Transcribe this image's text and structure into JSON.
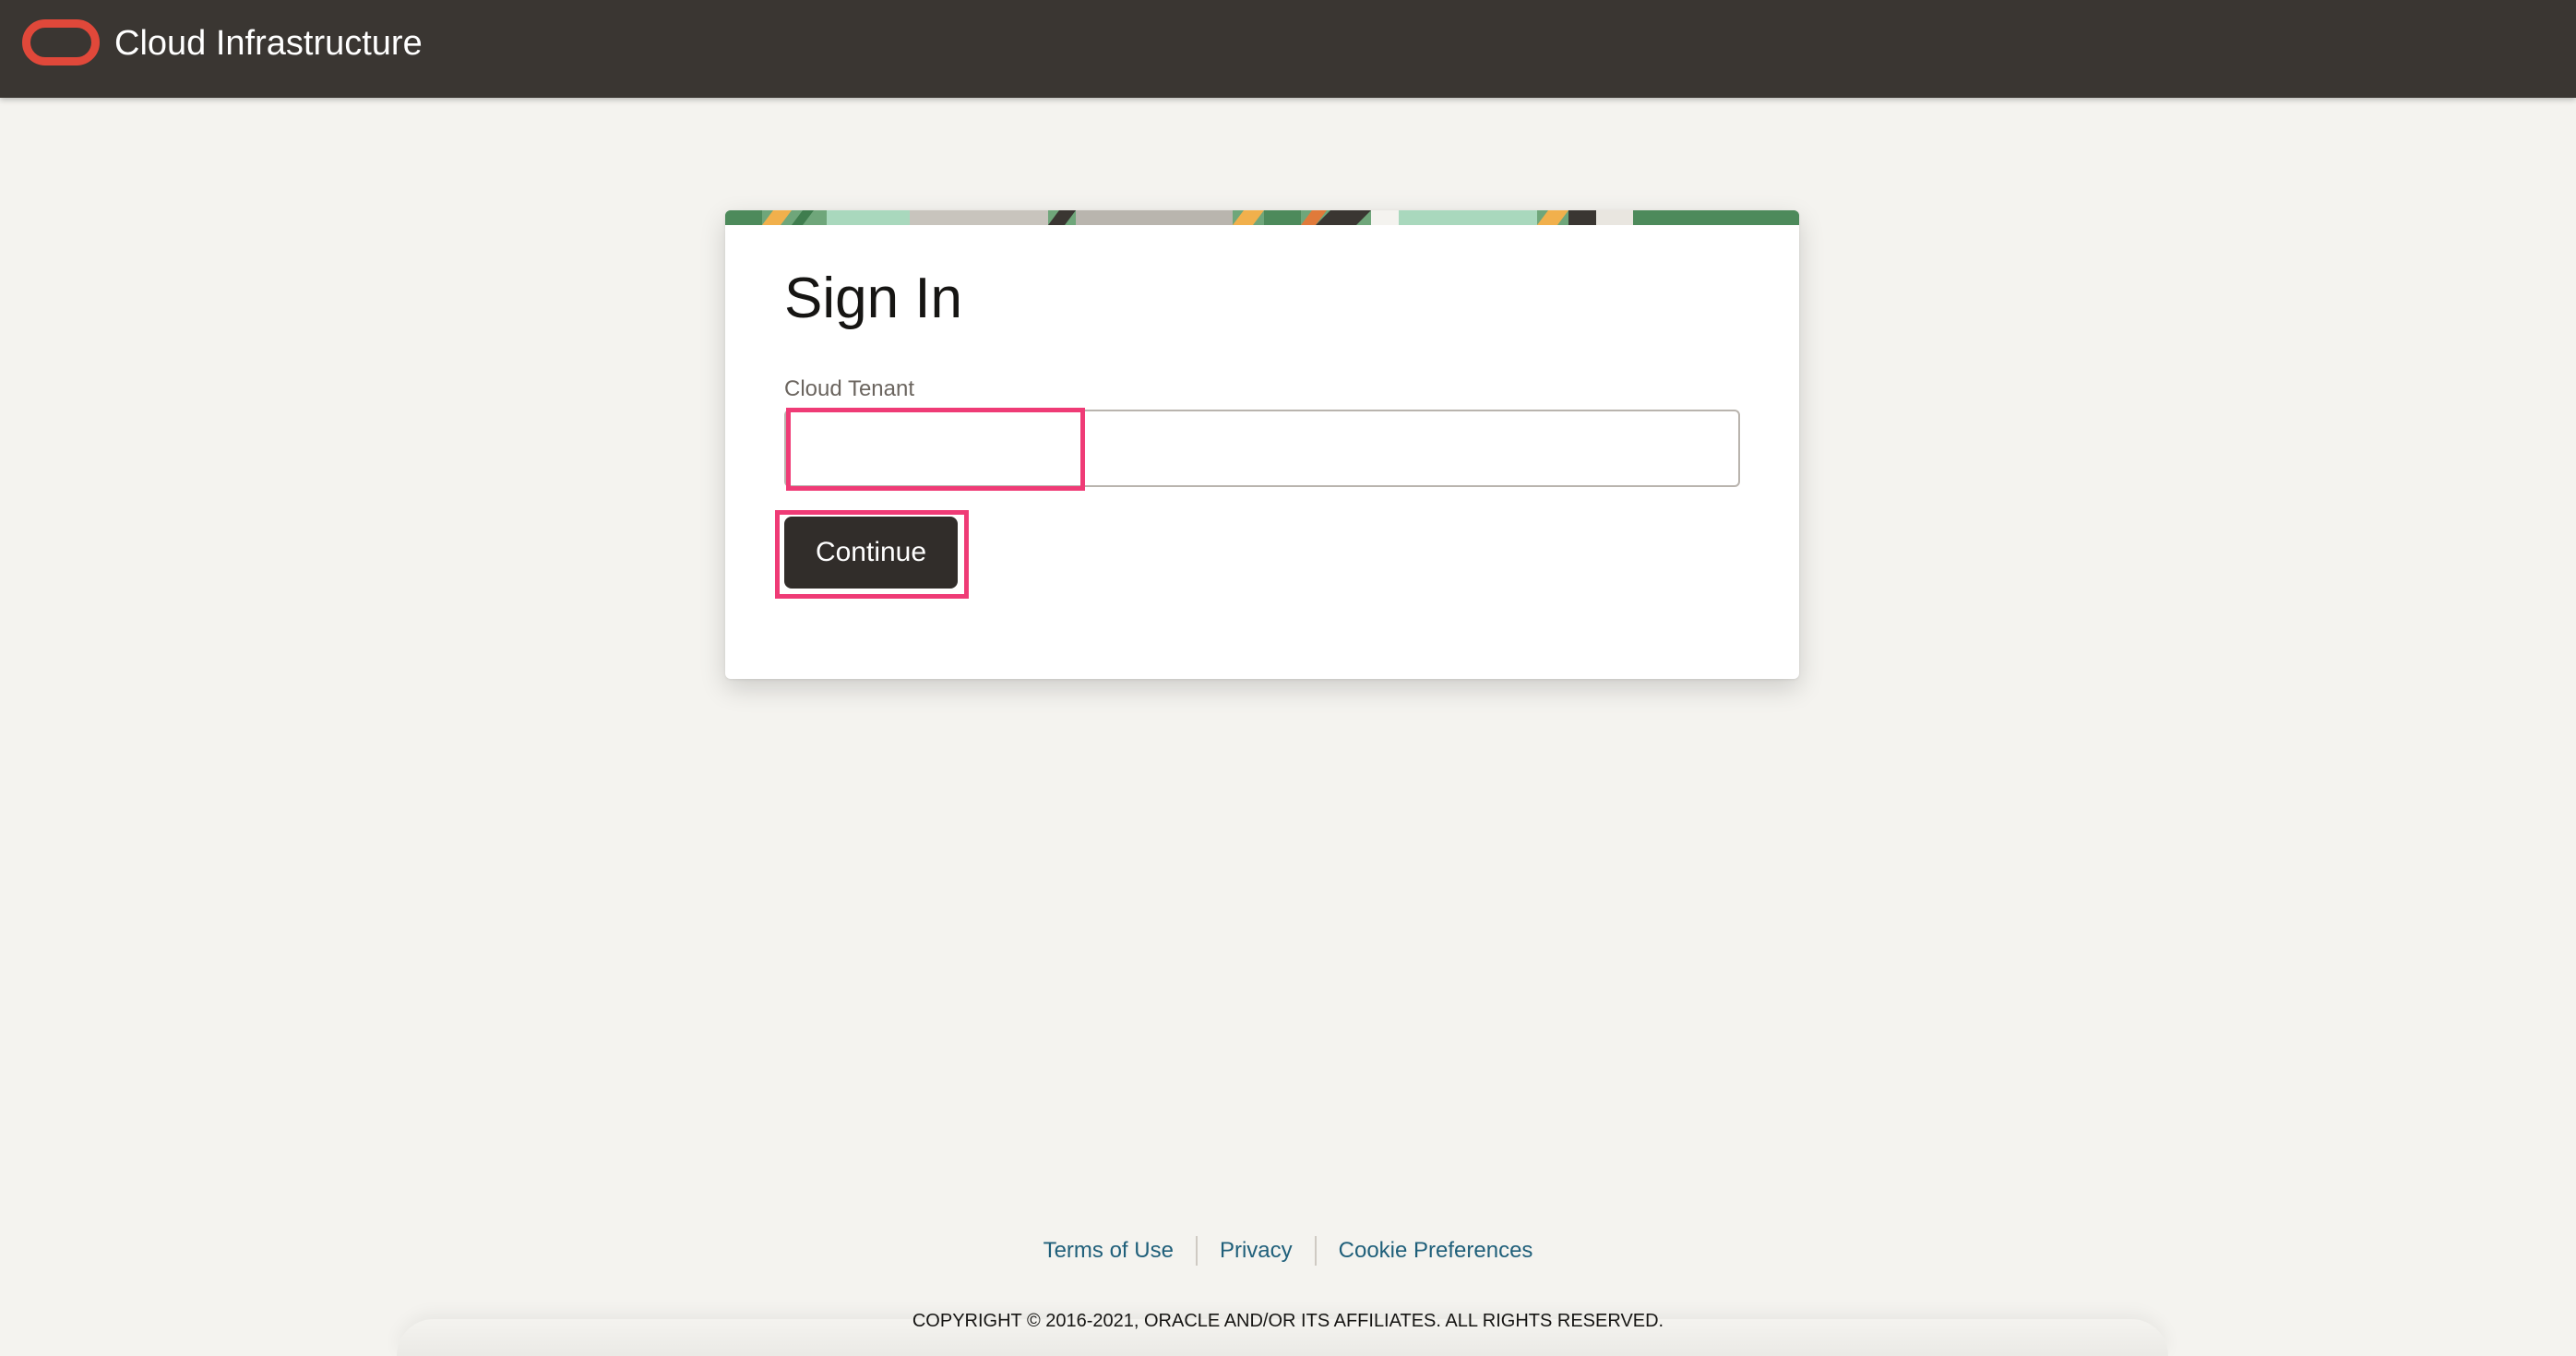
{
  "header": {
    "title": "Cloud Infrastructure",
    "logo_icon": "oracle-logo-icon",
    "background_color": "#3a3632",
    "logo_color": "#e0483a"
  },
  "signin": {
    "title": "Sign In",
    "tenant_label": "Cloud Tenant",
    "tenant_value": "",
    "continue_label": "Continue"
  },
  "footer": {
    "links": [
      "Terms of Use",
      "Privacy",
      "Cookie Preferences"
    ],
    "copyright": "COPYRIGHT © 2016-2021, ORACLE AND/OR ITS AFFILIATES. ALL RIGHTS RESERVED.",
    "link_color": "#1f5f7a"
  },
  "annotation": {
    "highlight_color": "#ef3b76"
  }
}
